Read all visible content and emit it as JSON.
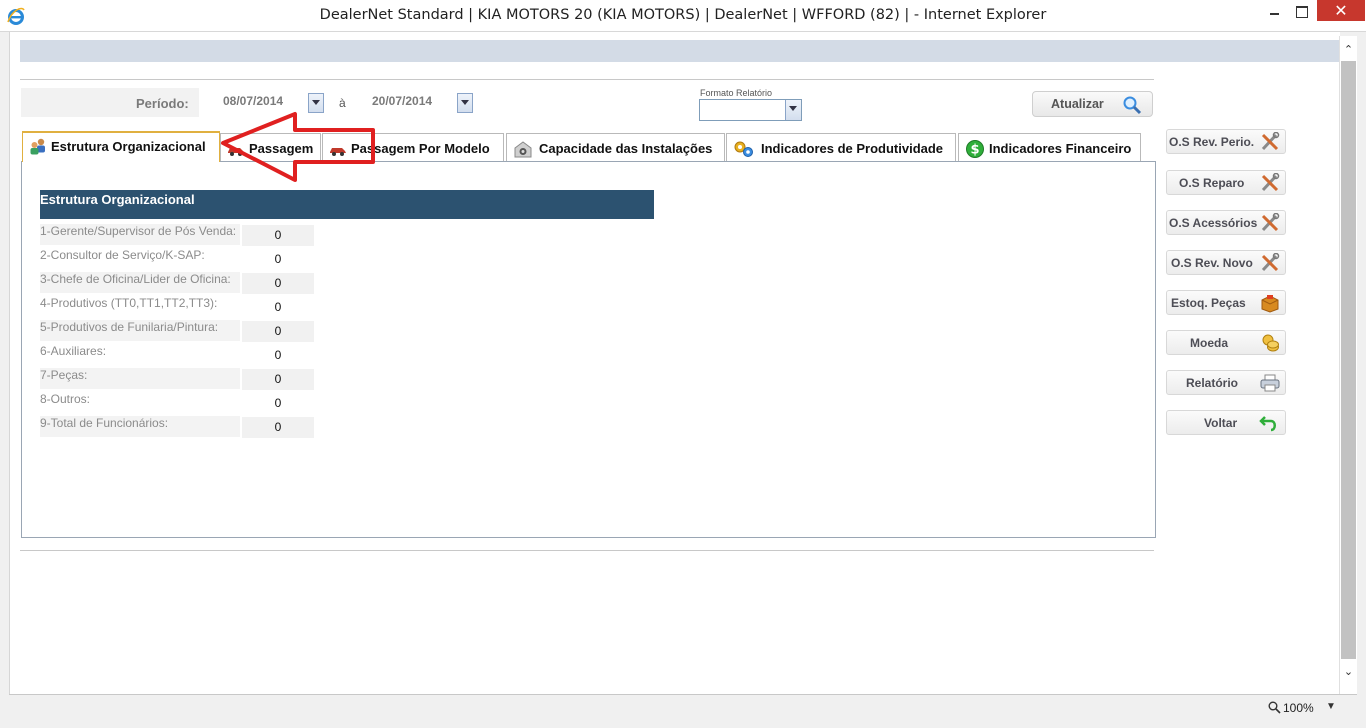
{
  "window": {
    "title": "DealerNet Standard | KIA MOTORS 20 (KIA MOTORS) | DealerNet | WFFORD (82) | - Internet Explorer",
    "close_glyph": "✕"
  },
  "filters": {
    "periodo_label": "Período:",
    "date_from": "08/07/2014",
    "separator": "à",
    "date_to": "20/07/2014",
    "formato_label": "Formato Relatório",
    "formato_value": "",
    "atualizar_label": "Atualizar"
  },
  "tabs": [
    {
      "label": "Estrutura Organizacional",
      "icon": "users-icon",
      "active": true
    },
    {
      "label": "Passagem",
      "icon": "car-icon",
      "active": false
    },
    {
      "label": "Passagem Por Modelo",
      "icon": "car-icon",
      "active": false
    },
    {
      "label": "Capacidade das Instalações",
      "icon": "camera-icon",
      "active": false
    },
    {
      "label": "Indicadores de Produtividade",
      "icon": "gears-icon",
      "active": false
    },
    {
      "label": "Indicadores Financeiro",
      "icon": "dollar-icon",
      "active": false
    }
  ],
  "table": {
    "title": "Estrutura Organizacional",
    "rows": [
      {
        "label": "1-Gerente/Supervisor de Pós Venda:",
        "value": "0"
      },
      {
        "label": "2-Consultor de Serviço/K-SAP:",
        "value": "0"
      },
      {
        "label": "3-Chefe de Oficina/Lider de Oficina:",
        "value": "0"
      },
      {
        "label": "4-Produtivos (TT0,TT1,TT2,TT3):",
        "value": "0"
      },
      {
        "label": "5-Produtivos de Funilaria/Pintura:",
        "value": "0"
      },
      {
        "label": "6-Auxiliares:",
        "value": "0"
      },
      {
        "label": "7-Peças:",
        "value": "0"
      },
      {
        "label": "8-Outros:",
        "value": "0"
      },
      {
        "label": "9-Total de Funcionários:",
        "value": "0"
      }
    ]
  },
  "side_buttons": [
    {
      "label": "O.S Rev. Perio.",
      "icon": "tools-icon"
    },
    {
      "label": "O.S Reparo",
      "icon": "tools-icon"
    },
    {
      "label": "O.S Acessórios",
      "icon": "tools-icon"
    },
    {
      "label": "O.S Rev. Novo",
      "icon": "tools-icon"
    },
    {
      "label": "Estoq. Peças",
      "icon": "box-icon"
    },
    {
      "label": "Moeda",
      "icon": "coins-icon"
    },
    {
      "label": "Relatório",
      "icon": "printer-icon"
    },
    {
      "label": "Voltar",
      "icon": "back-arrow-icon"
    }
  ],
  "status": {
    "zoom": "100%"
  },
  "colors": {
    "table_header": "#2c5270",
    "active_tab_border": "#e0b040",
    "annotation": "#e02020",
    "close_button": "#c7372d"
  }
}
